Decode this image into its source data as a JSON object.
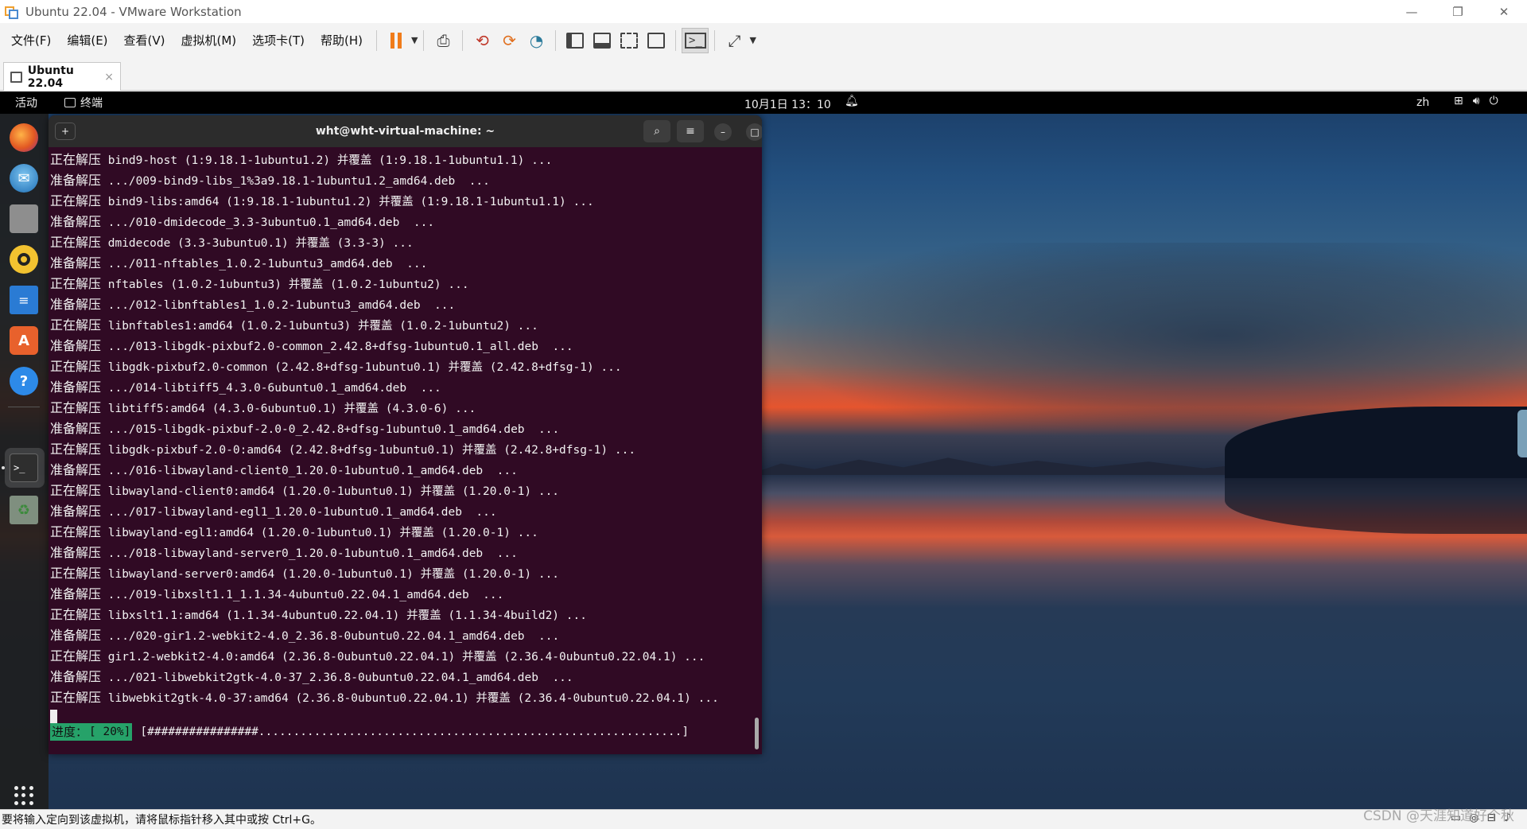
{
  "window": {
    "title": "Ubuntu 22.04 - VMware Workstation"
  },
  "menu": [
    "文件(F)",
    "编辑(E)",
    "查看(V)",
    "虚拟机(M)",
    "选项卡(T)",
    "帮助(H)"
  ],
  "tab": {
    "label": "Ubuntu 22.04",
    "close": "×"
  },
  "gnome": {
    "activities": "活动",
    "app_name": "终端",
    "clock": "10月1日  13：10",
    "lang": "zh"
  },
  "terminal": {
    "title": "wht@wht-virtual-machine: ~",
    "lines": [
      {
        "label": "正在解压",
        "text": " bind9-host (1:9.18.1-1ubuntu1.2) 并覆盖 (1:9.18.1-1ubuntu1.1) ..."
      },
      {
        "label": "准备解压",
        "text": " .../009-bind9-libs_1%3a9.18.1-1ubuntu1.2_amd64.deb  ..."
      },
      {
        "label": "正在解压",
        "text": " bind9-libs:amd64 (1:9.18.1-1ubuntu1.2) 并覆盖 (1:9.18.1-1ubuntu1.1) ..."
      },
      {
        "label": "准备解压",
        "text": " .../010-dmidecode_3.3-3ubuntu0.1_amd64.deb  ..."
      },
      {
        "label": "正在解压",
        "text": " dmidecode (3.3-3ubuntu0.1) 并覆盖 (3.3-3) ..."
      },
      {
        "label": "准备解压",
        "text": " .../011-nftables_1.0.2-1ubuntu3_amd64.deb  ..."
      },
      {
        "label": "正在解压",
        "text": " nftables (1.0.2-1ubuntu3) 并覆盖 (1.0.2-1ubuntu2) ..."
      },
      {
        "label": "准备解压",
        "text": " .../012-libnftables1_1.0.2-1ubuntu3_amd64.deb  ..."
      },
      {
        "label": "正在解压",
        "text": " libnftables1:amd64 (1.0.2-1ubuntu3) 并覆盖 (1.0.2-1ubuntu2) ..."
      },
      {
        "label": "准备解压",
        "text": " .../013-libgdk-pixbuf2.0-common_2.42.8+dfsg-1ubuntu0.1_all.deb  ..."
      },
      {
        "label": "正在解压",
        "text": " libgdk-pixbuf2.0-common (2.42.8+dfsg-1ubuntu0.1) 并覆盖 (2.42.8+dfsg-1) ..."
      },
      {
        "label": "准备解压",
        "text": " .../014-libtiff5_4.3.0-6ubuntu0.1_amd64.deb  ..."
      },
      {
        "label": "正在解压",
        "text": " libtiff5:amd64 (4.3.0-6ubuntu0.1) 并覆盖 (4.3.0-6) ..."
      },
      {
        "label": "准备解压",
        "text": " .../015-libgdk-pixbuf-2.0-0_2.42.8+dfsg-1ubuntu0.1_amd64.deb  ..."
      },
      {
        "label": "正在解压",
        "text": " libgdk-pixbuf-2.0-0:amd64 (2.42.8+dfsg-1ubuntu0.1) 并覆盖 (2.42.8+dfsg-1) ..."
      },
      {
        "label": "准备解压",
        "text": " .../016-libwayland-client0_1.20.0-1ubuntu0.1_amd64.deb  ..."
      },
      {
        "label": "正在解压",
        "text": " libwayland-client0:amd64 (1.20.0-1ubuntu0.1) 并覆盖 (1.20.0-1) ..."
      },
      {
        "label": "准备解压",
        "text": " .../017-libwayland-egl1_1.20.0-1ubuntu0.1_amd64.deb  ..."
      },
      {
        "label": "正在解压",
        "text": " libwayland-egl1:amd64 (1.20.0-1ubuntu0.1) 并覆盖 (1.20.0-1) ..."
      },
      {
        "label": "准备解压",
        "text": " .../018-libwayland-server0_1.20.0-1ubuntu0.1_amd64.deb  ..."
      },
      {
        "label": "正在解压",
        "text": " libwayland-server0:amd64 (1.20.0-1ubuntu0.1) 并覆盖 (1.20.0-1) ..."
      },
      {
        "label": "准备解压",
        "text": " .../019-libxslt1.1_1.1.34-4ubuntu0.22.04.1_amd64.deb  ..."
      },
      {
        "label": "正在解压",
        "text": " libxslt1.1:amd64 (1.1.34-4ubuntu0.22.04.1) 并覆盖 (1.1.34-4build2) ..."
      },
      {
        "label": "准备解压",
        "text": " .../020-gir1.2-webkit2-4.0_2.36.8-0ubuntu0.22.04.1_amd64.deb  ..."
      },
      {
        "label": "正在解压",
        "text": " gir1.2-webkit2-4.0:amd64 (2.36.8-0ubuntu0.22.04.1) 并覆盖 (2.36.4-0ubuntu0.22.04.1) ..."
      },
      {
        "label": "准备解压",
        "text": " .../021-libwebkit2gtk-4.0-37_2.36.8-0ubuntu0.22.04.1_amd64.deb  ..."
      },
      {
        "label": "正在解压",
        "text": " libwebkit2gtk-4.0-37:amd64 (2.36.8-0ubuntu0.22.04.1) 并覆盖 (2.36.4-0ubuntu0.22.04.1) ..."
      }
    ],
    "progress": {
      "label": "进度：",
      "value": "[ 20%]",
      "bar": "[################.............................................................]",
      "fraction": 0.2
    }
  },
  "status": {
    "message": "要将输入定向到该虚拟机，请将鼠标指针移入其中或按 Ctrl+G。",
    "watermark": "CSDN @天涯知道好个秋"
  },
  "colors": {
    "terminal_bg": "#300a24",
    "progress_green": "#26a269",
    "pause_orange": "#f07c1a"
  }
}
